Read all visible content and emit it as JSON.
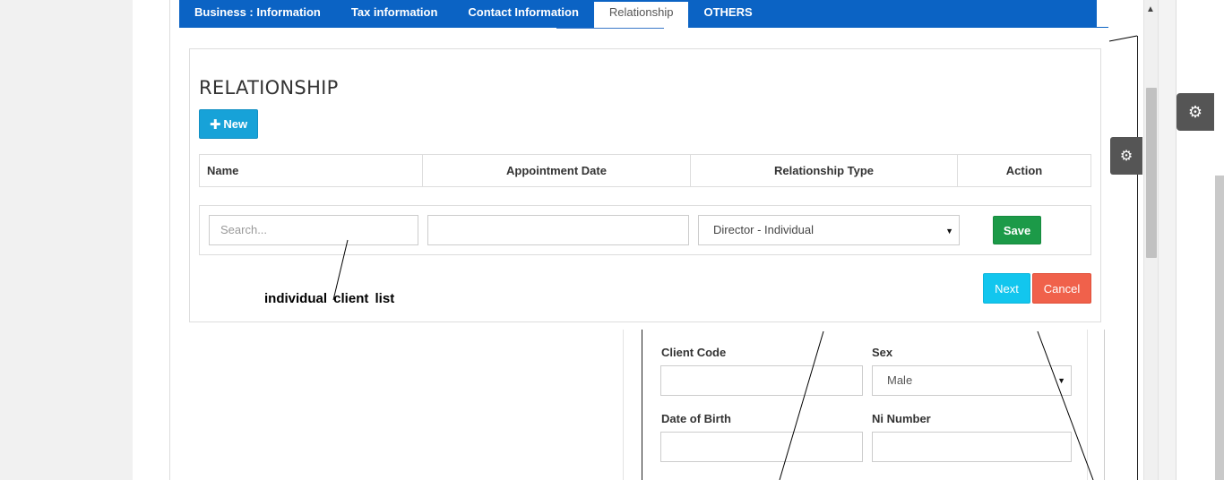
{
  "tabs": [
    {
      "label": "Business : Information",
      "active": false
    },
    {
      "label": "Tax information",
      "active": false
    },
    {
      "label": "Contact Information",
      "active": false
    },
    {
      "label": "Relationship",
      "active": true
    },
    {
      "label": "OTHERS",
      "active": false
    }
  ],
  "modal": {
    "title": "RELATIONSHIP",
    "new_button": "New",
    "table_headers": {
      "name": "Name",
      "appointment_date": "Appointment Date",
      "relationship_type": "Relationship Type",
      "action": "Action"
    },
    "row": {
      "search_placeholder": "Search...",
      "appointment_date_value": "",
      "relationship_type_value": "Director - Individual",
      "save_button": "Save"
    },
    "next_button": "Next",
    "cancel_button": "Cancel"
  },
  "annotation": "individual client list",
  "background_form": {
    "client_code_label": "Client Code",
    "sex_label": "Sex",
    "sex_value": "Male",
    "dob_label": "Date of Birth",
    "ni_label": "Ni Number"
  },
  "icons": {
    "settings": "gear-icon",
    "scroll_up": "arrow-up-icon",
    "dropdown": "caret-down-icon",
    "add": "plus-icon"
  },
  "colors": {
    "tab_bar": "#0b63c4",
    "new_button": "#17a2d8",
    "save_button": "#1c9a48",
    "next_button": "#12c6ee",
    "cancel_button": "#f0614b",
    "gear_button": "#555555"
  }
}
